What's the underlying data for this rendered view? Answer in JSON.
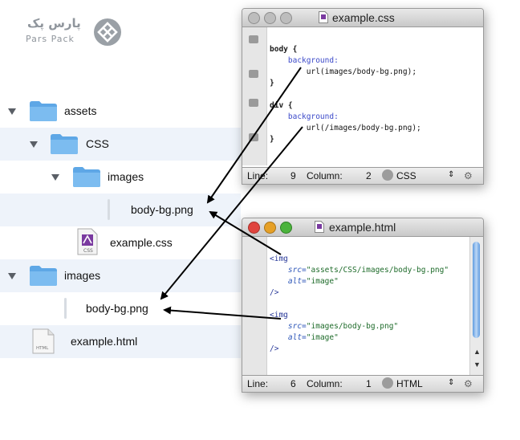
{
  "logo": {
    "text_fa": "پارس پک",
    "text_en": "Pars Pack"
  },
  "tree": [
    {
      "label": "assets",
      "type": "folder",
      "level": 0,
      "expanded": true
    },
    {
      "label": "CSS",
      "type": "folder",
      "level": 1,
      "expanded": true
    },
    {
      "label": "images",
      "type": "folder",
      "level": 2,
      "expanded": true
    },
    {
      "label": "body-bg.png",
      "type": "file",
      "level": 3
    },
    {
      "label": "example.css",
      "type": "css-file",
      "level": 2
    },
    {
      "label": "images",
      "type": "folder",
      "level": 0,
      "expanded": true
    },
    {
      "label": "body-bg.png",
      "type": "file",
      "level": 1
    },
    {
      "label": "example.html",
      "type": "html-file",
      "level": 0
    }
  ],
  "css_window": {
    "title": "example.css",
    "status": {
      "line_label": "Line:",
      "line": "9",
      "column_label": "Column:",
      "column": "2",
      "syntax": "CSS"
    },
    "lines": [
      {
        "selector": "body {",
        "prop": "",
        "value": ""
      },
      {
        "selector": "",
        "prop": "background:",
        "value": ""
      },
      {
        "selector": "",
        "prop": "",
        "value": "url(images/body-bg.png);"
      },
      {
        "selector": "}",
        "prop": "",
        "value": ""
      },
      {
        "selector": "",
        "prop": "",
        "value": ""
      },
      {
        "selector": "div {",
        "prop": "",
        "value": ""
      },
      {
        "selector": "",
        "prop": "background:",
        "value": ""
      },
      {
        "selector": "",
        "prop": "",
        "value": "url(/images/body-bg.png);"
      },
      {
        "selector": "}",
        "prop": "",
        "value": ""
      }
    ]
  },
  "html_window": {
    "title": "example.html",
    "status": {
      "line_label": "Line:",
      "line": "6",
      "column_label": "Column:",
      "column": "1",
      "syntax": "HTML"
    },
    "blocks": [
      {
        "open": "<img",
        "src_attr": "src=",
        "src_val": "\"assets/CSS/images/body-bg.png\"",
        "alt_attr": "alt=",
        "alt_val": "\"image\"",
        "close": "/>"
      },
      {
        "open": "<img",
        "src_attr": "src=",
        "src_val": "\"images/body-bg.png\"",
        "alt_attr": "alt=",
        "alt_val": "\"image\"",
        "close": "/>"
      }
    ]
  },
  "colors": {
    "light_close": "#e0443e",
    "light_min": "#e6a026",
    "light_max": "#4bb33c",
    "folder": "#5ea7e6",
    "row_alt": "#eef3fa"
  }
}
